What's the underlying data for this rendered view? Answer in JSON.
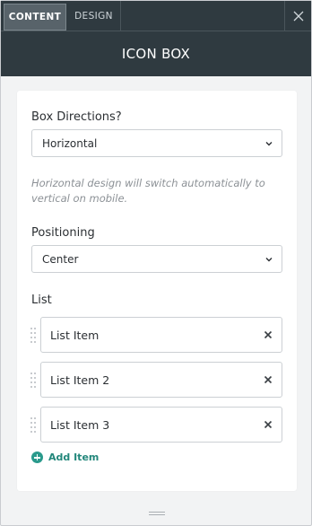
{
  "tabs": [
    {
      "label": "CONTENT",
      "active": true
    },
    {
      "label": "DESIGN",
      "active": false
    }
  ],
  "header": {
    "title": "ICON BOX"
  },
  "form": {
    "box_directions": {
      "label": "Box Directions?",
      "value": "Horizontal",
      "help": "Horizontal design will switch automatically to vertical on mobile."
    },
    "positioning": {
      "label": "Positioning",
      "value": "Center"
    },
    "list": {
      "label": "List",
      "items": [
        "List Item",
        "List Item 2",
        "List Item 3"
      ],
      "add_label": "Add Item"
    }
  },
  "colors": {
    "header_bg": "#2f3a40",
    "accent": "#2a9a8c"
  },
  "icons": {
    "close": "close-icon",
    "chevron": "chevron-down-icon",
    "remove": "remove-icon",
    "drag": "drag-handle-icon",
    "add": "plus-circle-icon"
  }
}
